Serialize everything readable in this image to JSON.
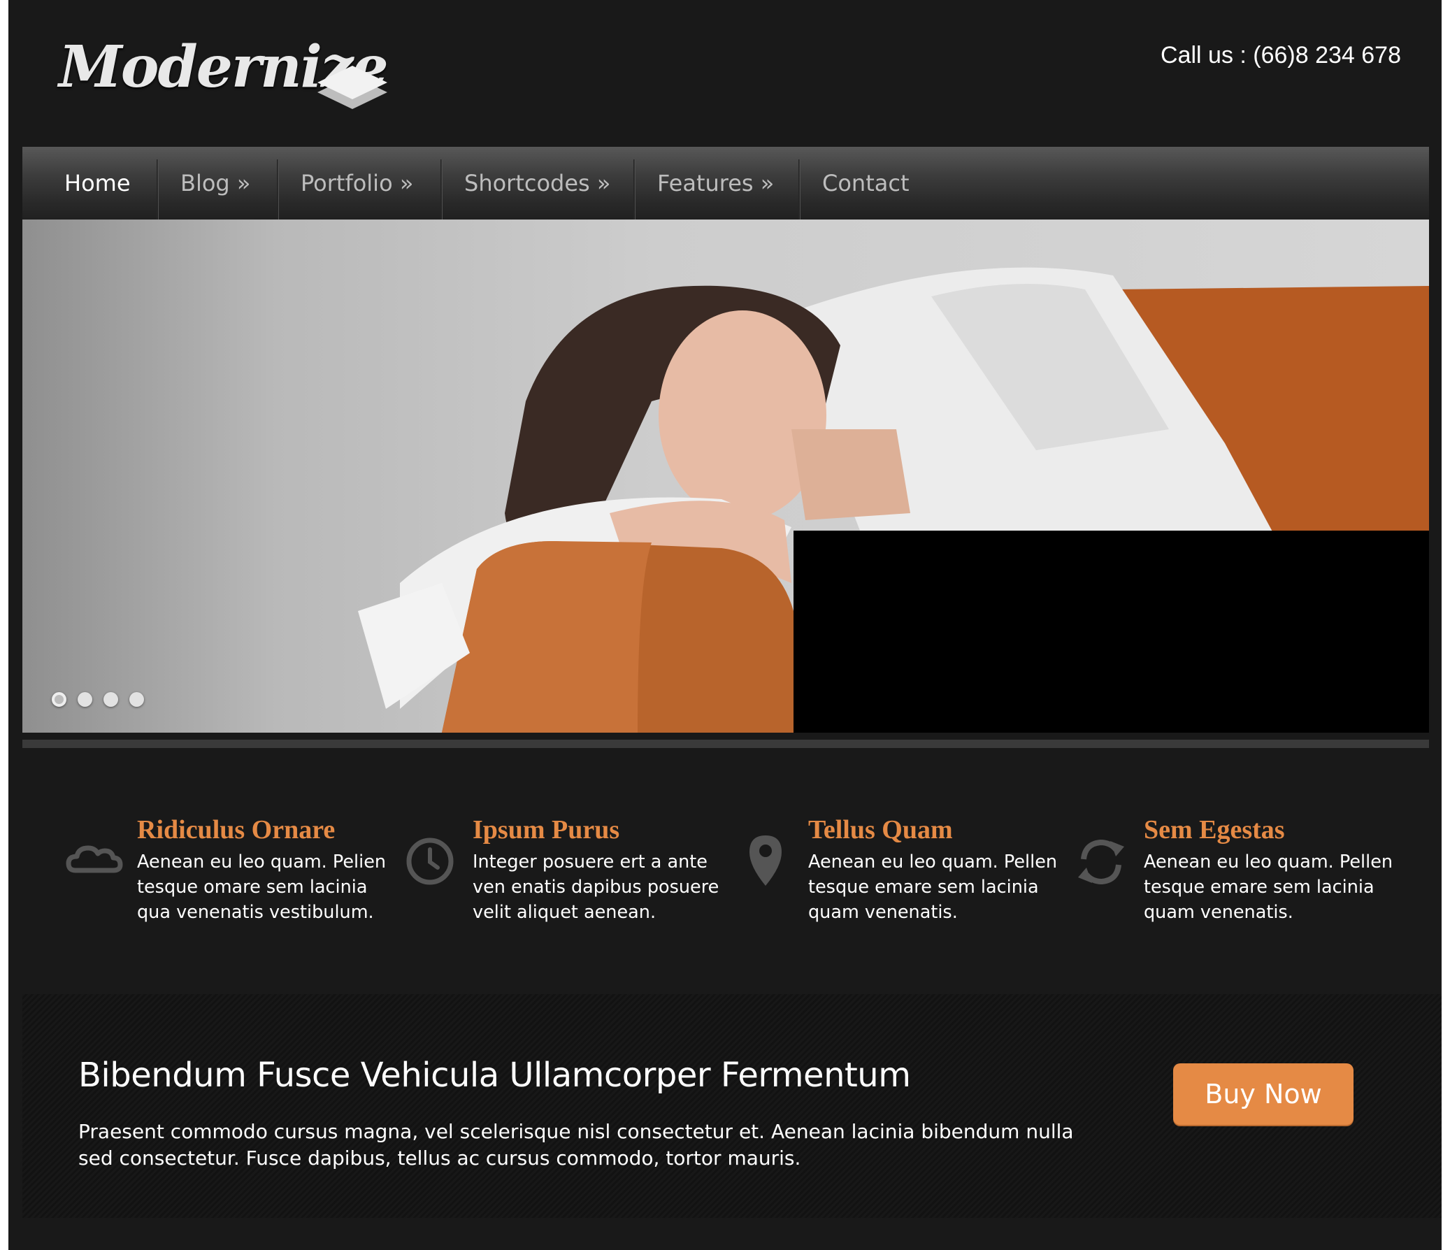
{
  "header": {
    "logo_text": "Modernize",
    "phone": "Call us : (66)8 234 678"
  },
  "nav": {
    "items": [
      {
        "label": "Home",
        "active": true
      },
      {
        "label": "Blog »",
        "active": false
      },
      {
        "label": "Portfolio »",
        "active": false
      },
      {
        "label": "Shortcodes »",
        "active": false
      },
      {
        "label": "Features »",
        "active": false
      },
      {
        "label": "Contact",
        "active": false
      }
    ]
  },
  "slider": {
    "slide_count": 4,
    "active_slide": 1
  },
  "features": [
    {
      "icon": "cloud-icon",
      "title": "Ridiculus Ornare",
      "text": "Aenean eu leo quam. Pelien tesque omare sem lacinia qua venenatis vestibulum."
    },
    {
      "icon": "clock-icon",
      "title": "Ipsum Purus",
      "text": "Integer posuere ert a ante ven enatis dapibus posuere velit aliquet aenean."
    },
    {
      "icon": "map-pin-icon",
      "title": "Tellus Quam",
      "text": "Aenean eu leo quam. Pellen tesque emare sem lacinia quam venenatis."
    },
    {
      "icon": "refresh-icon",
      "title": "Sem Egestas",
      "text": "Aenean eu leo quam. Pellen tesque emare sem lacinia quam venenatis."
    }
  ],
  "cta": {
    "title": "Bibendum Fusce Vehicula Ullamcorper Fermentum",
    "text": "Praesent commodo cursus magna, vel scelerisque nisl consectetur et. Aenean lacinia bibendum nulla sed consectetur. Fusce dapibus, tellus ac cursus commodo, tortor mauris.",
    "button_label": "Buy Now"
  },
  "colors": {
    "page_bg": "#191919",
    "accent": "#e58a45",
    "nav_text": "#bdbdbd",
    "text": "#ffffff"
  }
}
